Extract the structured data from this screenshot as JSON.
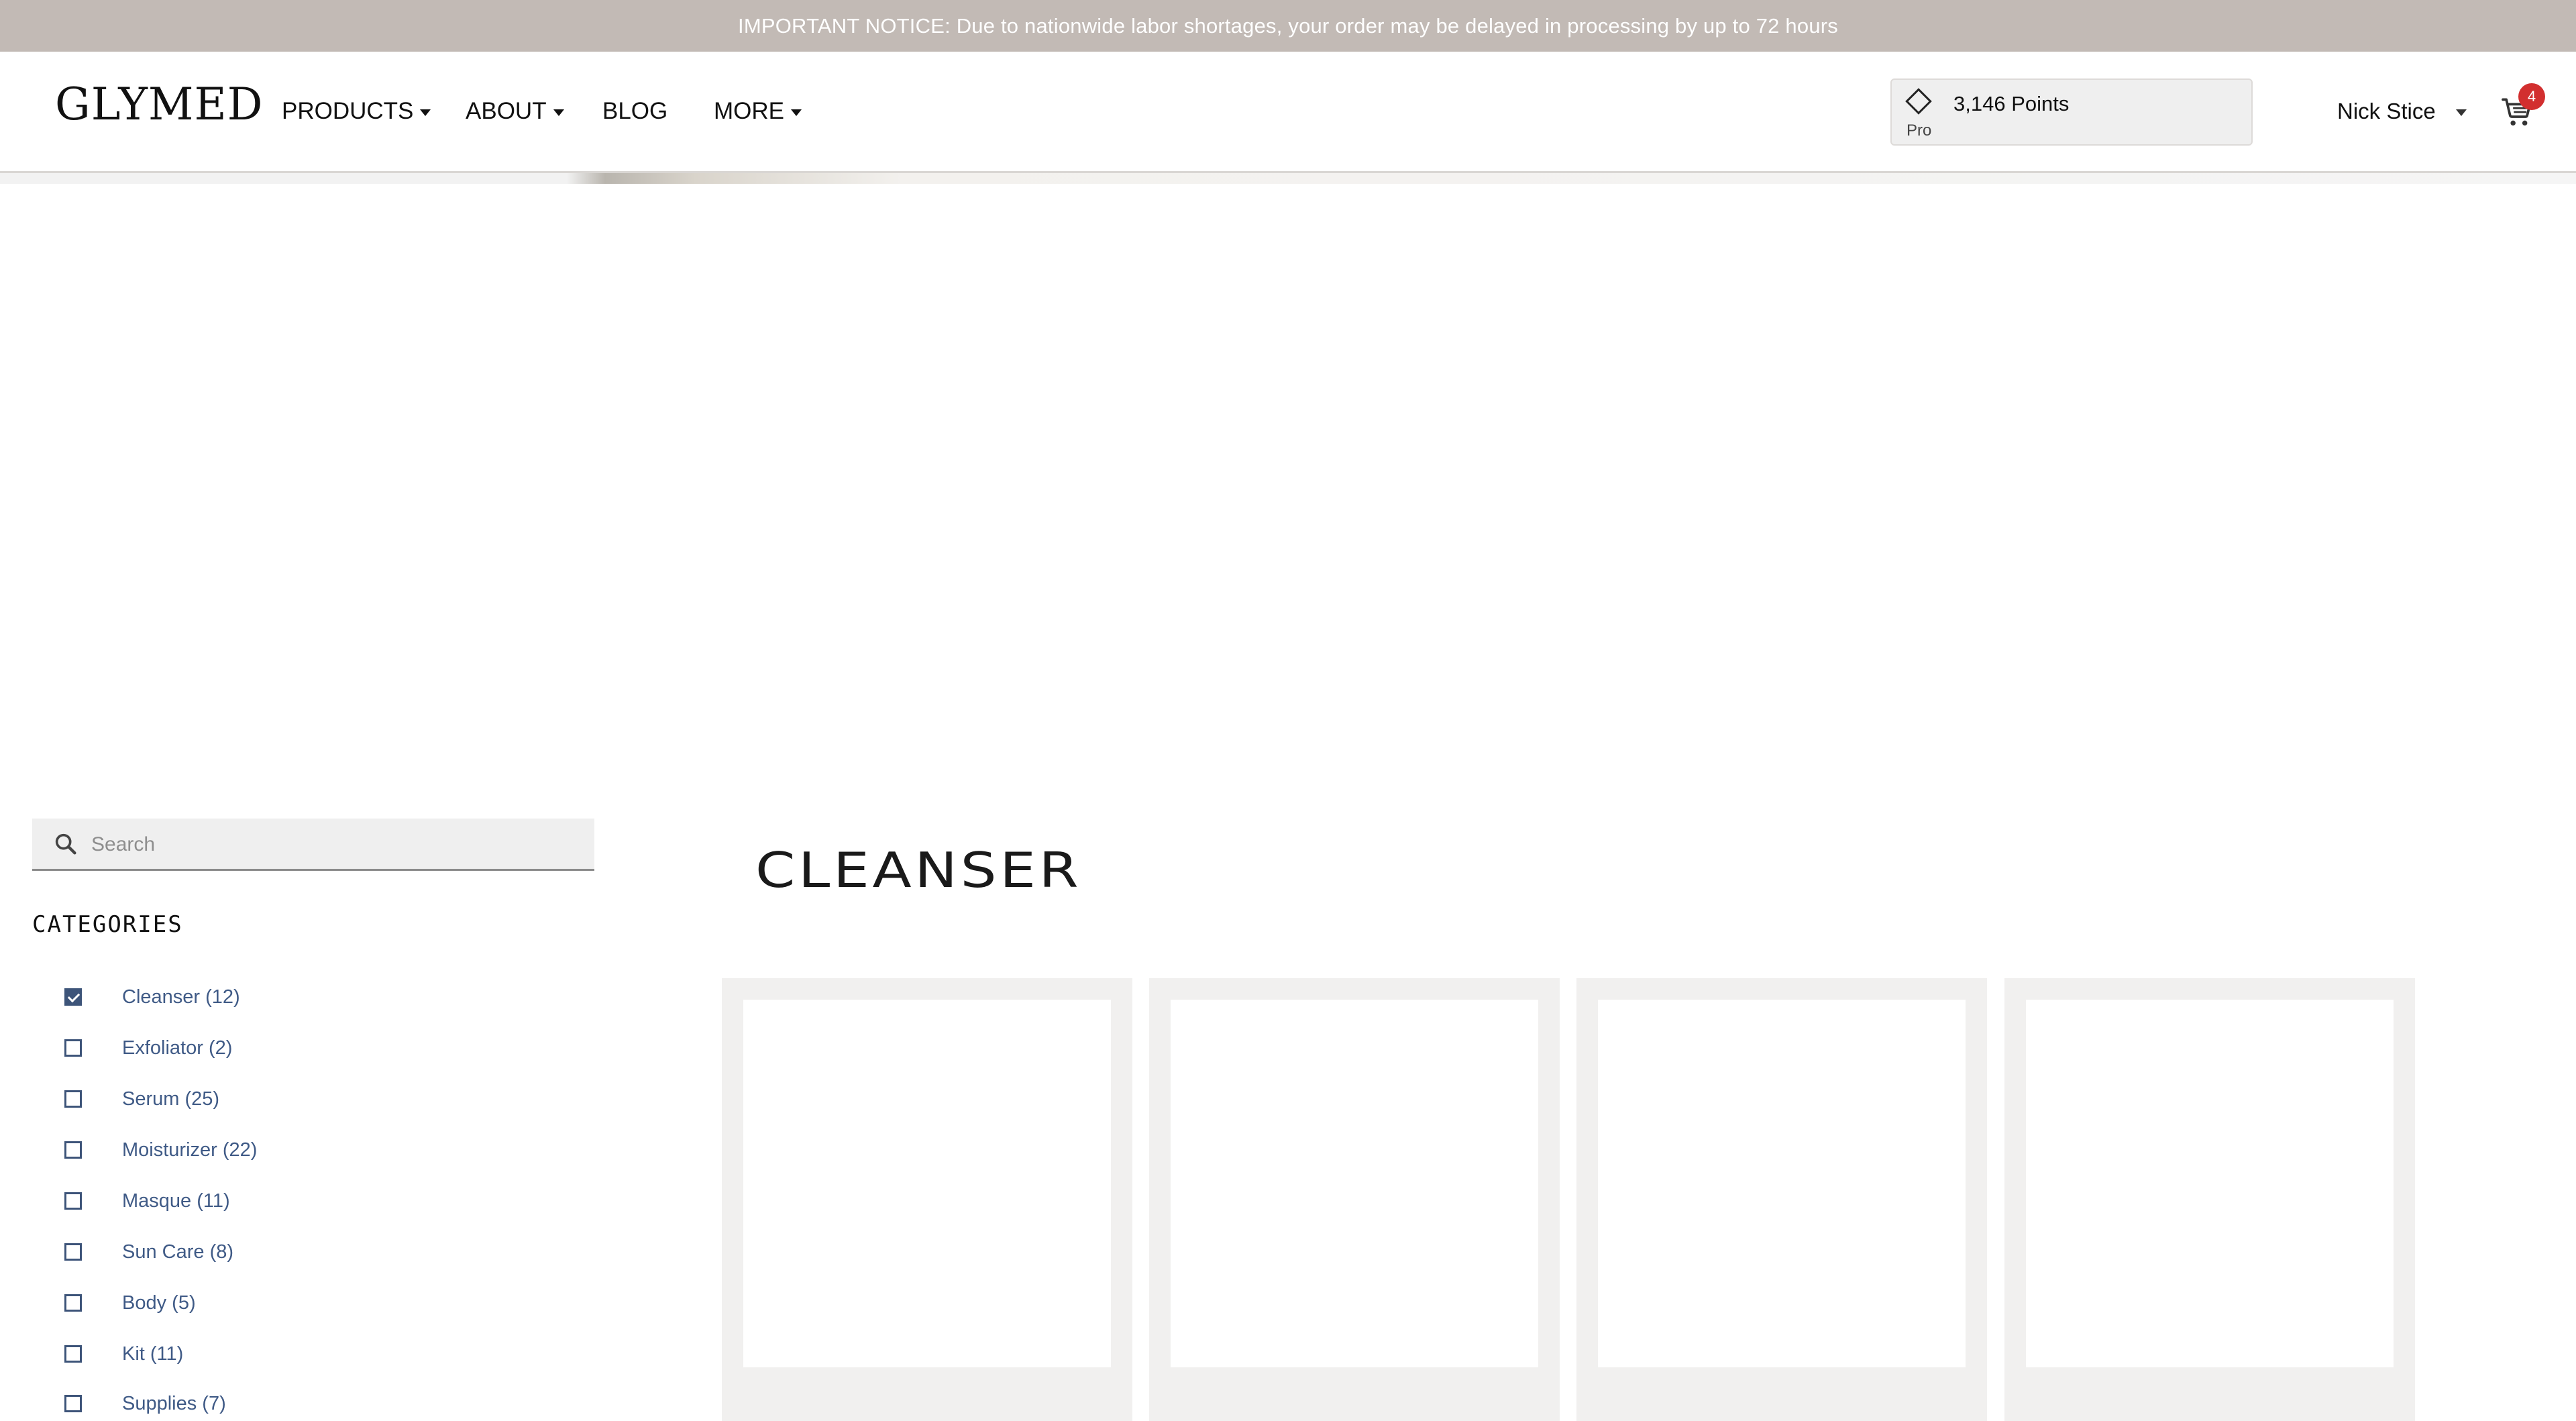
{
  "notice": {
    "text": "IMPORTANT NOTICE: Due to nationwide labor shortages, your order may be delayed in processing by up to 72 hours"
  },
  "header": {
    "logo": "GLYMED",
    "nav": [
      {
        "label": "PRODUCTS",
        "dropdown": true
      },
      {
        "label": "ABOUT",
        "dropdown": true
      },
      {
        "label": "BLOG",
        "dropdown": false
      },
      {
        "label": "MORE",
        "dropdown": true
      }
    ],
    "points": {
      "value": "3,146 Points",
      "tier": "Pro",
      "icon": "diamond-icon"
    },
    "user": {
      "name": "Nick Stice"
    },
    "cart": {
      "icon": "cart-icon",
      "count": "4"
    }
  },
  "sidebar": {
    "search": {
      "placeholder": "Search",
      "value": ""
    },
    "categories_heading": "CATEGORIES",
    "categories": [
      {
        "label": "Cleanser (12)",
        "checked": true
      },
      {
        "label": "Exfoliator (2)",
        "checked": false
      },
      {
        "label": "Serum (25)",
        "checked": false
      },
      {
        "label": "Moisturizer (22)",
        "checked": false
      },
      {
        "label": "Masque (11)",
        "checked": false
      },
      {
        "label": "Sun Care (8)",
        "checked": false
      },
      {
        "label": "Body (5)",
        "checked": false
      },
      {
        "label": "Kit (11)",
        "checked": false
      },
      {
        "label": "Supplies (7)",
        "checked": false
      }
    ]
  },
  "main": {
    "title": "CLEANSER"
  },
  "colors": {
    "notice_bg": "#c2bab5",
    "category_link": "#3f5a86",
    "checkbox": "#3d5479",
    "cart_badge": "#d22f2f",
    "card_bg": "#f1f0ef"
  }
}
